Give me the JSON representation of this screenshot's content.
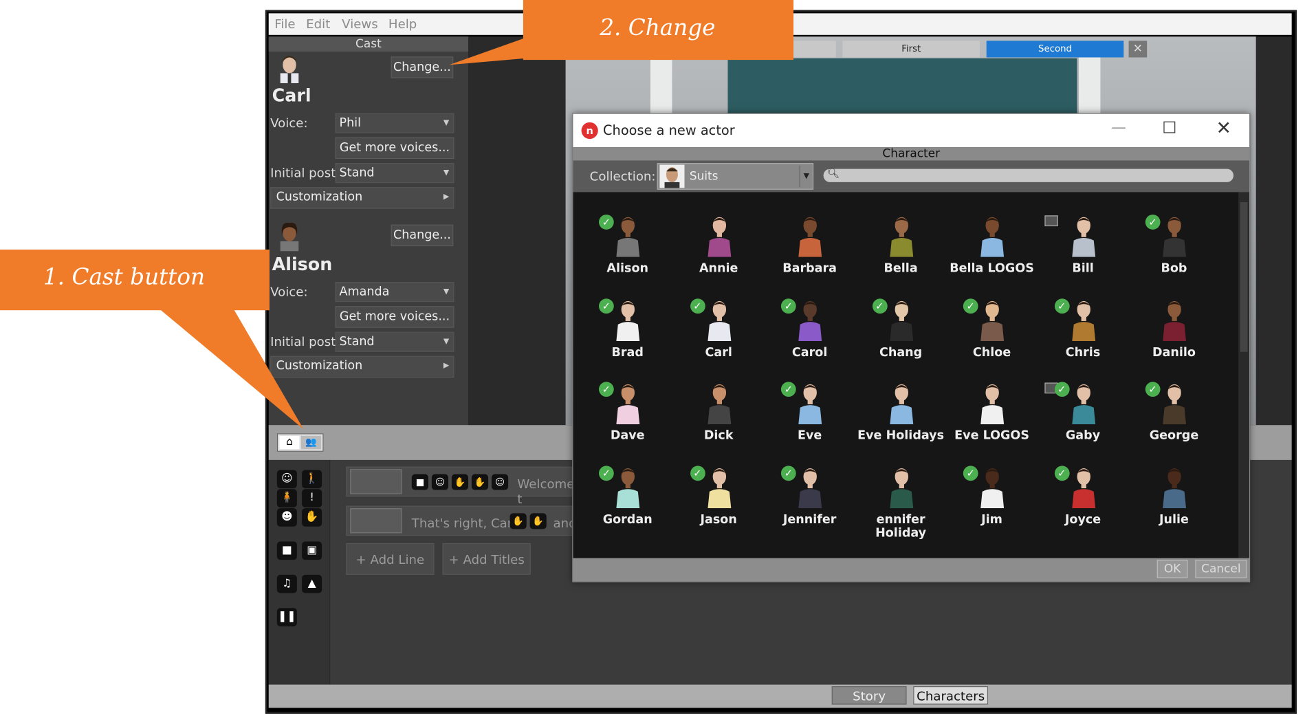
{
  "menu": {
    "items": [
      "File",
      "Edit",
      "Views",
      "Help"
    ]
  },
  "cast": {
    "title": "Cast",
    "actors": [
      {
        "name": "Carl",
        "change": "Change...",
        "voice_label": "Voice:",
        "voice": "Phil",
        "more_voices": "Get more voices...",
        "post_label": "Initial post",
        "post": "Stand",
        "custom": "Customization"
      },
      {
        "name": "Alison",
        "change": "Change...",
        "voice_label": "Voice:",
        "voice": "Amanda",
        "more_voices": "Get more voices...",
        "post_label": "Initial post",
        "post": "Stand",
        "custom": "Customization"
      }
    ]
  },
  "viewport": {
    "tabs": [
      "First",
      "Second"
    ],
    "active_tab": "Second"
  },
  "timeline": {
    "line1_text": "Welcome t",
    "line2_text": "That's right, Carl –",
    "line2_tail": "and",
    "add_line": "+ Add Line",
    "add_titles": "+ Add Titles"
  },
  "bottom_tabs": {
    "story": "Story",
    "characters": "Characters"
  },
  "dialog": {
    "title": "Choose a new actor",
    "header": "Character",
    "collection_label": "Collection:",
    "collection_value": "Suits",
    "ok": "OK",
    "cancel": "Cancel",
    "characters": [
      {
        "name": "Alison",
        "checked": true,
        "pic": false,
        "skin": "#8a5a3b",
        "shirt": "#777"
      },
      {
        "name": "Annie",
        "checked": false,
        "pic": false,
        "skin": "#e2b8a0",
        "shirt": "#a04a8c"
      },
      {
        "name": "Barbara",
        "checked": false,
        "pic": false,
        "skin": "#7a4a2e",
        "shirt": "#c8643c"
      },
      {
        "name": "Bella",
        "checked": false,
        "pic": false,
        "skin": "#9a6a48",
        "shirt": "#8a8a2e"
      },
      {
        "name": "Bella LOGOS",
        "checked": false,
        "pic": true,
        "skin": "#7a4a2e",
        "shirt": "#8ab8e0"
      },
      {
        "name": "Bill",
        "checked": false,
        "pic": false,
        "skin": "#e2c0a8",
        "shirt": "#b8c0cc"
      },
      {
        "name": "Bob",
        "checked": true,
        "pic": false,
        "skin": "#8a5a3b",
        "shirt": "#333"
      },
      {
        "name": "Brad",
        "checked": true,
        "pic": false,
        "skin": "#e2c0a8",
        "shirt": "#f0f0f0"
      },
      {
        "name": "Carl",
        "checked": true,
        "pic": false,
        "skin": "#e2c0a8",
        "shirt": "#e8e8f0"
      },
      {
        "name": "Carol",
        "checked": true,
        "pic": false,
        "skin": "#5a3a2a",
        "shirt": "#8a5ac8"
      },
      {
        "name": "Chang",
        "checked": true,
        "pic": false,
        "skin": "#e2c8a8",
        "shirt": "#2a2a2a"
      },
      {
        "name": "Chloe",
        "checked": true,
        "pic": false,
        "skin": "#e2b890",
        "shirt": "#7a5a4a"
      },
      {
        "name": "Chris",
        "checked": true,
        "pic": false,
        "skin": "#e2c0a8",
        "shirt": "#b07a30"
      },
      {
        "name": "Danilo",
        "checked": false,
        "pic": false,
        "skin": "#8a5a3b",
        "shirt": "#7a2030"
      },
      {
        "name": "Dave",
        "checked": true,
        "pic": false,
        "skin": "#c8906a",
        "shirt": "#f0d0e0"
      },
      {
        "name": "Dick",
        "checked": false,
        "pic": false,
        "skin": "#c8906a",
        "shirt": "#444"
      },
      {
        "name": "Eve",
        "checked": true,
        "pic": false,
        "skin": "#e2c0a8",
        "shirt": "#8ab8e0"
      },
      {
        "name": "Eve Holidays",
        "checked": false,
        "pic": false,
        "skin": "#e2c0a8",
        "shirt": "#8ab8e0"
      },
      {
        "name": "Eve LOGOS",
        "checked": false,
        "pic": true,
        "skin": "#e2c0a8",
        "shirt": "#f0f0f0"
      },
      {
        "name": "Gaby",
        "checked": true,
        "pic": false,
        "skin": "#e2c0a8",
        "shirt": "#3a8a9a"
      },
      {
        "name": "George",
        "checked": true,
        "pic": false,
        "skin": "#e2c0a8",
        "shirt": "#4a3a2a"
      },
      {
        "name": "Gordan",
        "checked": true,
        "pic": false,
        "skin": "#8a5a3b",
        "shirt": "#a8e0d8"
      },
      {
        "name": "Jason",
        "checked": true,
        "pic": false,
        "skin": "#e2c0a8",
        "shirt": "#f0e0a0"
      },
      {
        "name": "Jennifer",
        "checked": true,
        "pic": false,
        "skin": "#e2c0a8",
        "shirt": "#3a3a4a"
      },
      {
        "name": "ennifer Holiday",
        "checked": false,
        "pic": false,
        "skin": "#e2c0a8",
        "shirt": "#2a5a4a"
      },
      {
        "name": "Jim",
        "checked": true,
        "pic": false,
        "skin": "#4a2a1a",
        "shirt": "#f0f0f0"
      },
      {
        "name": "Joyce",
        "checked": true,
        "pic": false,
        "skin": "#e2c0a8",
        "shirt": "#c83030"
      },
      {
        "name": "Julie",
        "checked": false,
        "pic": false,
        "skin": "#4a2a1a",
        "shirt": "#4a6a8a"
      }
    ]
  },
  "callouts": {
    "cast_button": "1. Cast button",
    "change": "2. Change"
  }
}
